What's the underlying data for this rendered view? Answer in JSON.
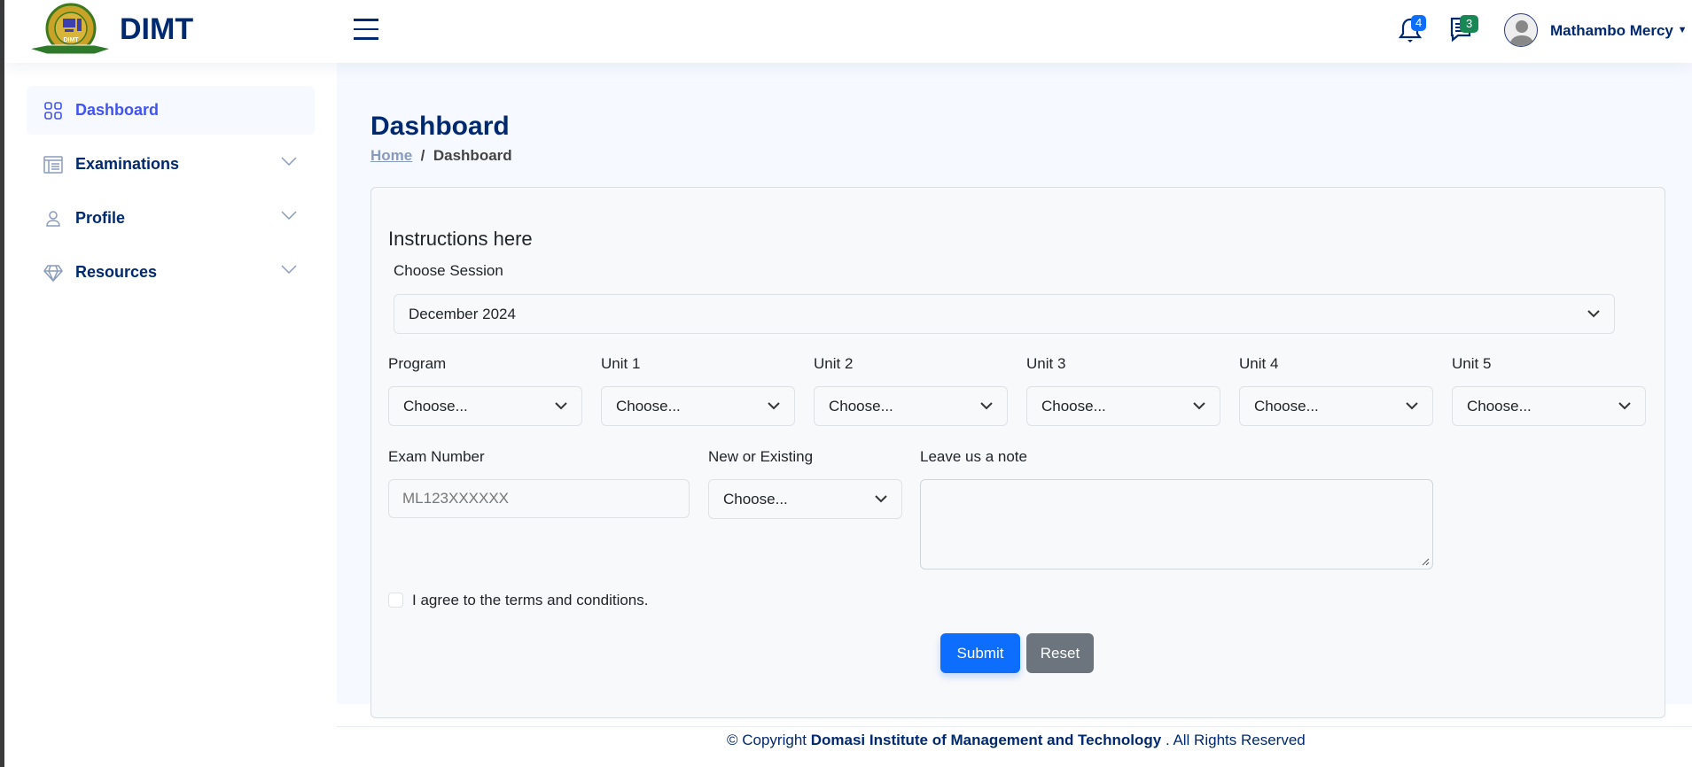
{
  "header": {
    "brand": "DIMT",
    "notifications_count": "4",
    "messages_count": "3",
    "user_name": "Mathambo Mercy",
    "colors": {
      "notif_badge": "#0d6efd",
      "msg_badge": "#198754"
    }
  },
  "sidebar": {
    "items": [
      {
        "label": "Dashboard",
        "icon": "grid-icon",
        "active": true
      },
      {
        "label": "Examinations",
        "icon": "layout-text-icon"
      },
      {
        "label": "Profile",
        "icon": "person-icon"
      },
      {
        "label": "Resources",
        "icon": "gem-icon"
      }
    ]
  },
  "page": {
    "title": "Dashboard",
    "breadcrumb": {
      "home": "Home",
      "current": "Dashboard"
    }
  },
  "form": {
    "instructions": "Instructions here",
    "session_label": "Choose Session",
    "session_value": "December 2024",
    "row_fields": [
      {
        "label": "Program",
        "value": "Choose..."
      },
      {
        "label": "Unit 1",
        "value": "Choose..."
      },
      {
        "label": "Unit 2",
        "value": "Choose..."
      },
      {
        "label": "Unit 3",
        "value": "Choose..."
      },
      {
        "label": "Unit 4",
        "value": "Choose..."
      },
      {
        "label": "Unit 5",
        "value": "Choose..."
      }
    ],
    "exam_number_label": "Exam Number",
    "exam_number_placeholder": "ML123XXXXXX",
    "new_existing_label": "New or Existing",
    "new_existing_value": "Choose...",
    "note_label": "Leave us a note",
    "note_value": "",
    "terms_label": "I agree to the terms and conditions.",
    "terms_checked": false,
    "submit_label": "Submit",
    "reset_label": "Reset"
  },
  "footer": {
    "prefix": "© Copyright",
    "org": "Domasi Institute of Management and Technology",
    "suffix": ". All Rights Reserved"
  }
}
